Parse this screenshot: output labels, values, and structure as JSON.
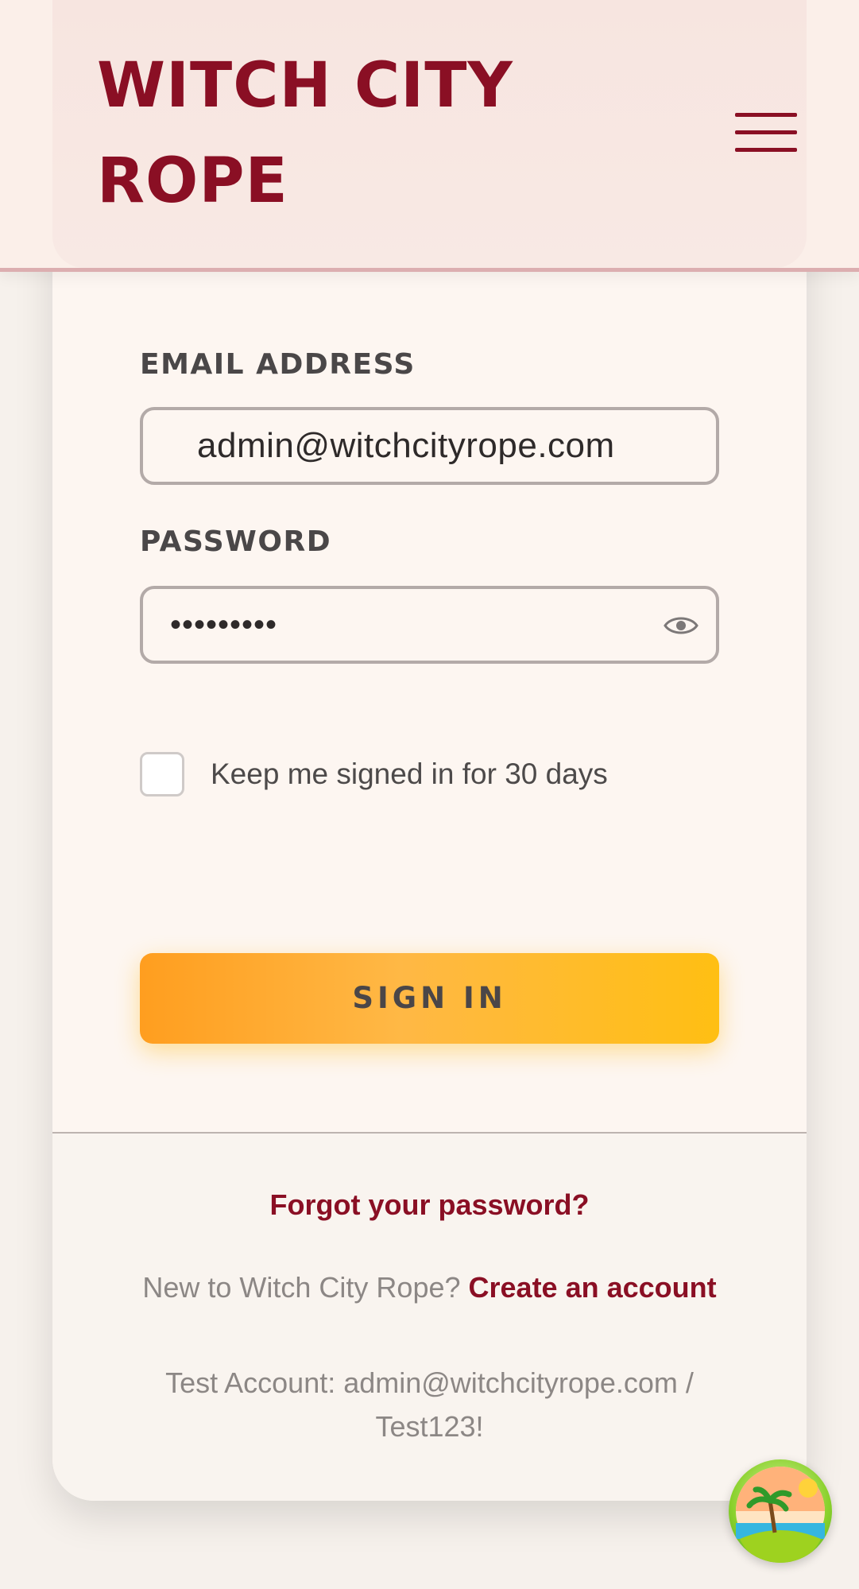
{
  "header": {
    "logo_line1": "WITCH CITY",
    "logo_line2": "ROPE"
  },
  "form": {
    "email_label": "EMAIL ADDRESS",
    "email_value": "admin@witchcityrope.com",
    "password_label": "PASSWORD",
    "password_value": "•••••••••",
    "remember_label": "Keep me signed in for 30 days",
    "remember_checked": false,
    "signin_label": "SIGN IN"
  },
  "footer": {
    "forgot_label": "Forgot your password?",
    "new_prefix": "New to Witch City Rope? ",
    "create_label": "Create an account",
    "test_account": "Test Account: admin@witchcityrope.com / Test123!"
  },
  "colors": {
    "brand": "#8a0f24",
    "accent_start": "#ff9e1f",
    "accent_end": "#ffbf13",
    "card_bg": "#fdf6f1"
  },
  "icons": {
    "menu": "hamburger-icon",
    "password_toggle": "eye-icon",
    "badge": "island-badge-icon"
  }
}
